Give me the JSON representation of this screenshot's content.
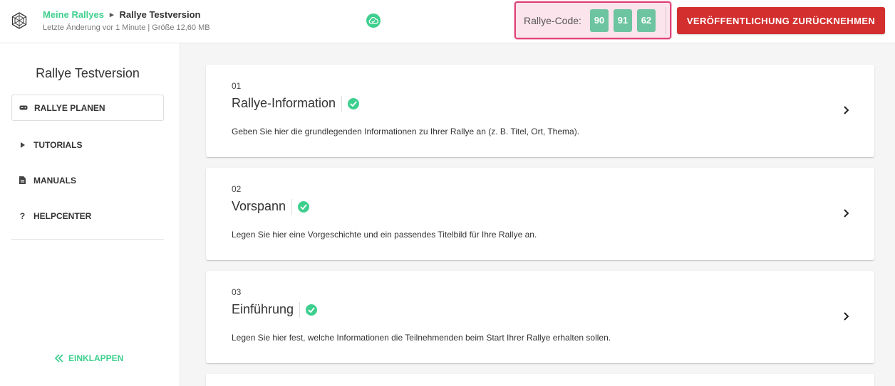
{
  "header": {
    "breadcrumb_link": "Meine Rallyes",
    "breadcrumb_current": "Rallye Testversion",
    "meta": "Letzte Änderung vor 1 Minute | Größe 12,60 MB",
    "code_label": "Rallye-Code:",
    "code_digits": [
      "90",
      "91",
      "62"
    ],
    "unpublish_label": "VERÖFFENTLICHUNG ZURÜCKNEHMEN"
  },
  "sidebar": {
    "title": "Rallye Testversion",
    "items": [
      {
        "label": "RALLYE PLANEN",
        "icon": "gamepad-icon",
        "active": true
      },
      {
        "label": "TUTORIALS",
        "icon": "play-icon",
        "active": false
      },
      {
        "label": "MANUALS",
        "icon": "document-icon",
        "active": false
      },
      {
        "label": "HELPCENTER",
        "icon": "question-icon",
        "active": false
      }
    ],
    "collapse_label": "EINKLAPPEN"
  },
  "cards": [
    {
      "num": "01",
      "title": "Rallye-Information",
      "desc": "Geben Sie hier die grundlegenden Informationen zu Ihrer Rallye an (z. B. Titel, Ort, Thema)."
    },
    {
      "num": "02",
      "title": "Vorspann",
      "desc": "Legen Sie hier eine Vorgeschichte und ein passendes Titelbild für Ihre Rallye an."
    },
    {
      "num": "03",
      "title": "Einführung",
      "desc": "Legen Sie hier fest, welche Informationen die Teilnehmenden beim Start Ihrer Rallye erhalten sollen."
    }
  ],
  "colors": {
    "accent": "#3ecf8e",
    "danger": "#d32f2f",
    "code_highlight": "#e0457b",
    "code_digit_bg": "#6cc4a0"
  }
}
